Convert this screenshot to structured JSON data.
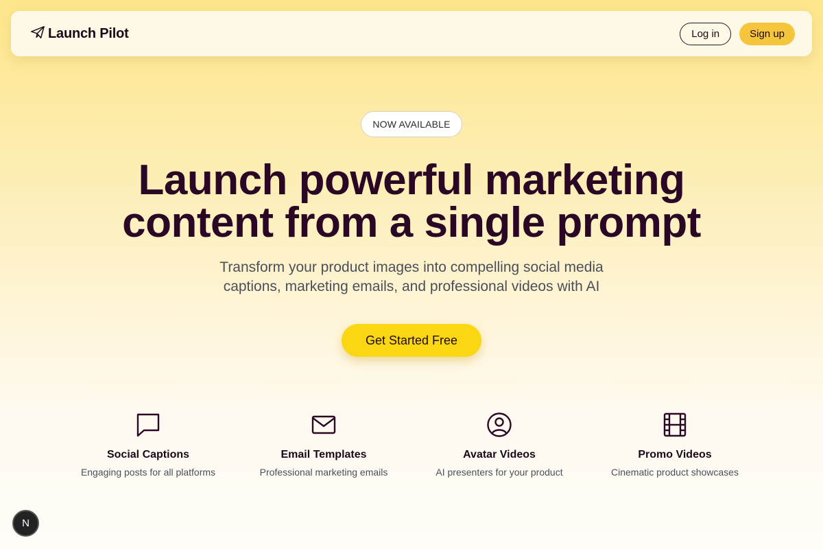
{
  "nav": {
    "logo_text": "Launch Pilot",
    "logo_icon": "paper-plane-icon",
    "login_label": "Log in",
    "signup_label": "Sign up"
  },
  "hero": {
    "badge": "NOW AVAILABLE",
    "headline_line1": "Launch powerful marketing",
    "headline_line2": "content from a single prompt",
    "subhead_line1": "Transform your product images into compelling social media",
    "subhead_line2": "captions, marketing emails, and professional videos with AI",
    "cta_label": "Get Started Free"
  },
  "features": [
    {
      "icon": "chat-bubble-icon",
      "title": "Social Captions",
      "desc": "Engaging posts for all platforms"
    },
    {
      "icon": "envelope-icon",
      "title": "Email Templates",
      "desc": "Professional marketing emails"
    },
    {
      "icon": "user-circle-icon",
      "title": "Avatar Videos",
      "desc": "AI presenters for your product"
    },
    {
      "icon": "film-icon",
      "title": "Promo Videos",
      "desc": "Cinematic product showcases"
    }
  ],
  "dev_badge": {
    "letter": "N"
  },
  "colors": {
    "accent_yellow": "#fbd713",
    "signup_yellow": "#f5c63c",
    "headline": "#2b0726",
    "body_text": "#4a4f5a"
  }
}
